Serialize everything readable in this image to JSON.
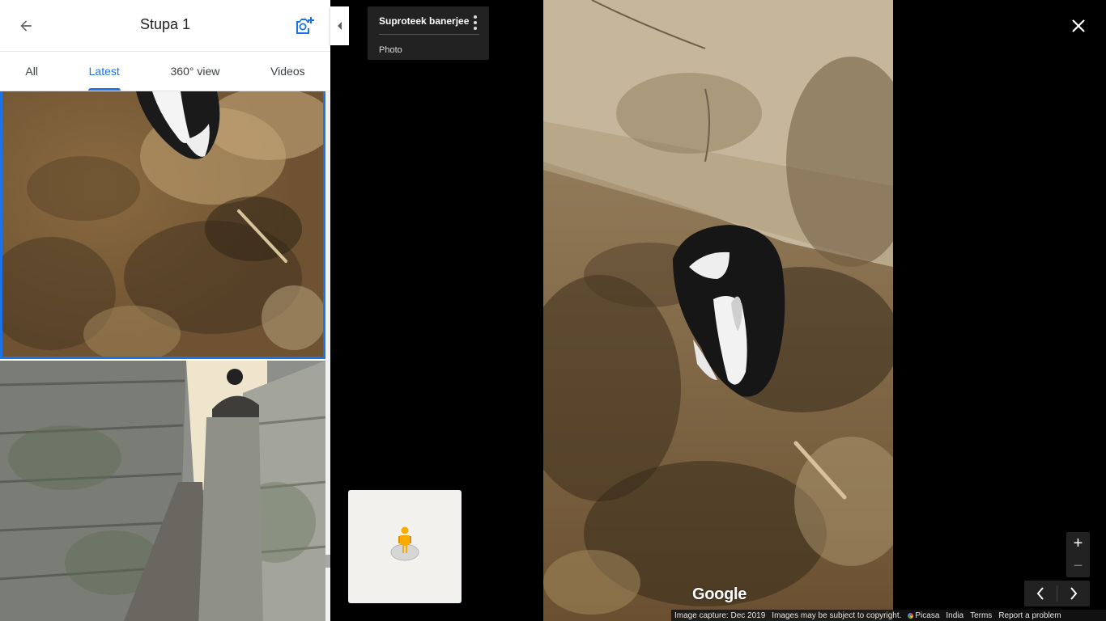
{
  "header": {
    "title": "Stupa 1",
    "back_icon": "arrow-back-icon",
    "add_photo_icon": "add-photo-camera-icon"
  },
  "tabs": [
    {
      "label": "All",
      "active": false
    },
    {
      "label": "Latest",
      "active": true
    },
    {
      "label": "360° view",
      "active": false
    },
    {
      "label": "Videos",
      "active": false
    }
  ],
  "thumbnails": [
    {
      "subject": "rabbit on dirt ground",
      "selected": true
    },
    {
      "subject": "stone wall corridor with person",
      "selected": false
    }
  ],
  "info_card": {
    "author": "Suproteek banerjee",
    "type": "Photo"
  },
  "main_photo": {
    "subject": "black and white rabbit on dry ground beside stone ledge"
  },
  "branding": {
    "logo_text": "Google"
  },
  "zoom": {
    "in_label": "+",
    "out_label": "−"
  },
  "footer": {
    "capture": "Image capture: Dec 2019",
    "copyright": "Images may be subject to copyright.",
    "picasa": "Picasa",
    "country": "India",
    "terms": "Terms",
    "report": "Report a problem"
  },
  "colors": {
    "accent": "#1a73e8",
    "panel_bg": "#ffffff",
    "viewer_bg": "#000000",
    "card_bg": "#222222"
  }
}
